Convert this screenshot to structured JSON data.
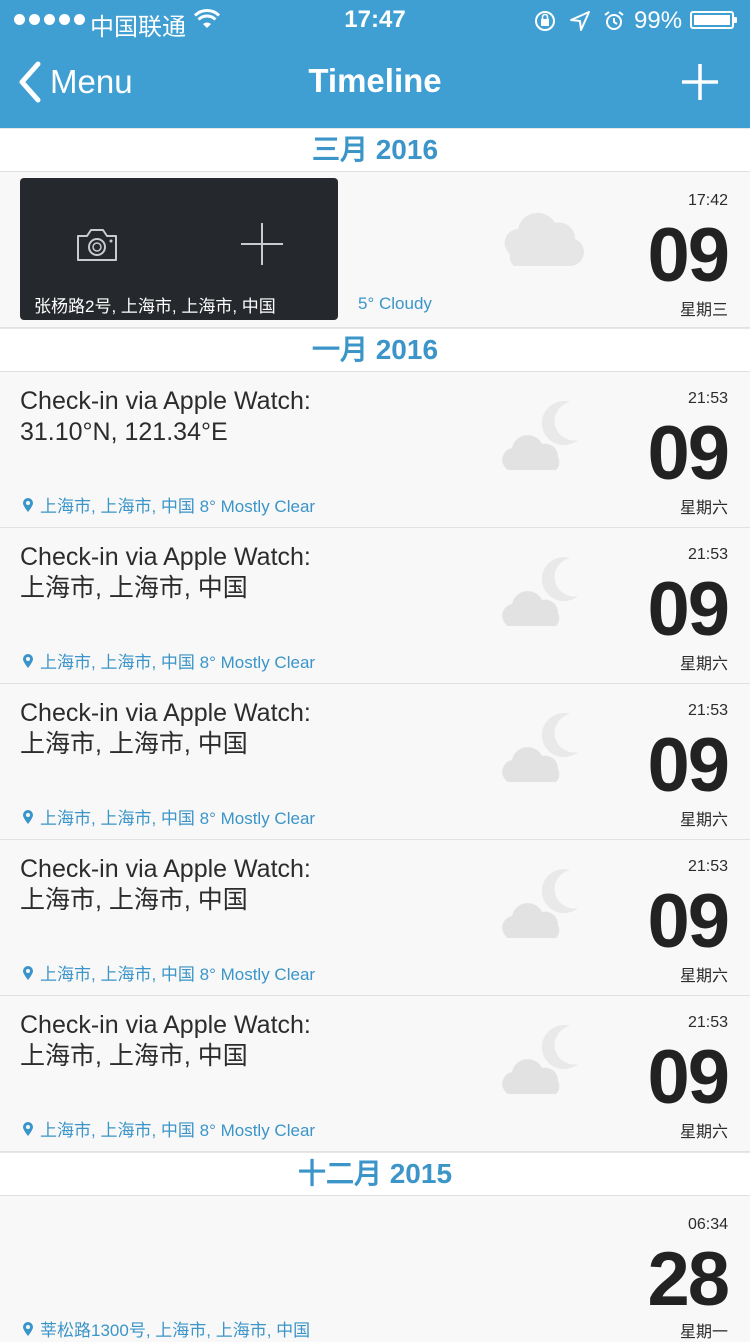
{
  "status_bar": {
    "carrier": "中国联通",
    "time": "17:47",
    "battery_percent": "99%"
  },
  "nav": {
    "back_label": "Menu",
    "title": "Timeline"
  },
  "sections": [
    {
      "label": "三月 2016"
    },
    {
      "label": "一月 2016"
    },
    {
      "label": "十二月 2015"
    }
  ],
  "first_entry": {
    "address": "张杨路2号, 上海市, 上海市, 中国",
    "weather": "5° Cloudy",
    "time": "17:42",
    "day": "09",
    "weekday": "星期三"
  },
  "entries": [
    {
      "title": "Check-in via Apple Watch:\n31.10°N, 121.34°E",
      "location": "上海市, 上海市, 中国 8° Mostly Clear",
      "time": "21:53",
      "day": "09",
      "weekday": "星期六"
    },
    {
      "title": "Check-in via Apple Watch:\n上海市, 上海市, 中国",
      "location": "上海市, 上海市, 中国 8° Mostly Clear",
      "time": "21:53",
      "day": "09",
      "weekday": "星期六"
    },
    {
      "title": "Check-in via Apple Watch:\n上海市, 上海市, 中国",
      "location": "上海市, 上海市, 中国 8° Mostly Clear",
      "time": "21:53",
      "day": "09",
      "weekday": "星期六"
    },
    {
      "title": "Check-in via Apple Watch:\n上海市, 上海市, 中国",
      "location": "上海市, 上海市, 中国 8° Mostly Clear",
      "time": "21:53",
      "day": "09",
      "weekday": "星期六"
    },
    {
      "title": "Check-in via Apple Watch:\n上海市, 上海市, 中国",
      "location": "上海市, 上海市, 中国 8° Mostly Clear",
      "time": "21:53",
      "day": "09",
      "weekday": "星期六"
    }
  ],
  "last_entry": {
    "location": "莘松路1300号, 上海市, 上海市, 中国",
    "time": "06:34",
    "day": "28",
    "weekday": "星期一"
  },
  "colors": {
    "accent": "#3f9fd3",
    "section_text": "#3b95c8"
  },
  "icons": {
    "weather_first": "cloud-icon",
    "weather_entries": "moon-cloud-icon"
  }
}
